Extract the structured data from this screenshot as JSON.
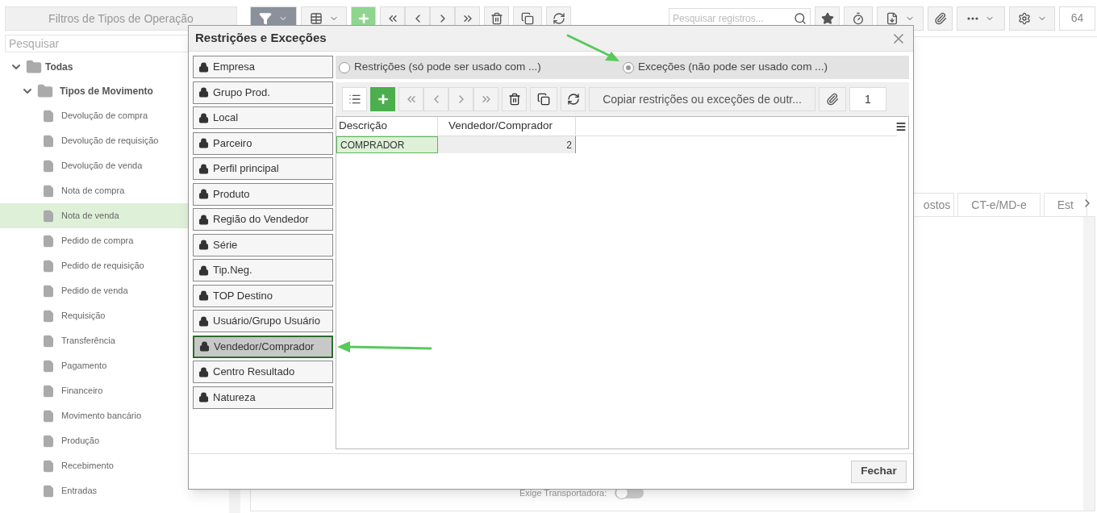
{
  "sidebar": {
    "title": "Filtros de Tipos de Operação",
    "search": {
      "placeholder": "Pesquisar"
    },
    "tree": [
      {
        "label": "Todas",
        "expanded": true,
        "children": [
          {
            "label": "Tipos de Movimento",
            "expanded": true,
            "children": [
              {
                "label": "Devolução de compra",
                "selected": false
              },
              {
                "label": "Devolução de requisição",
                "selected": false
              },
              {
                "label": "Devolução de venda",
                "selected": false
              },
              {
                "label": "Nota de compra",
                "selected": false
              },
              {
                "label": "Nota de venda",
                "selected": true
              },
              {
                "label": "Pedido de compra",
                "selected": false
              },
              {
                "label": "Pedido de requisição",
                "selected": false
              },
              {
                "label": "Pedido de venda",
                "selected": false
              },
              {
                "label": "Requisição",
                "selected": false
              },
              {
                "label": "Transferência",
                "selected": false
              },
              {
                "label": "Pagamento",
                "selected": false
              },
              {
                "label": "Financeiro",
                "selected": false
              },
              {
                "label": "Movimento bancário",
                "selected": false
              },
              {
                "label": "Produção",
                "selected": false
              },
              {
                "label": "Recebimento",
                "selected": false
              },
              {
                "label": "Entradas",
                "selected": false
              }
            ]
          }
        ]
      }
    ]
  },
  "toolbar": {
    "search": {
      "placeholder": "Pesquisar registros..."
    },
    "counter": "64"
  },
  "tabs": [
    {
      "label": "ostos"
    },
    {
      "label": "CT-e/MD-e"
    },
    {
      "label": "Est"
    }
  ],
  "form": {
    "label": "Exige Transportadora:",
    "on": false
  },
  "dialog": {
    "title": "Restrições e Exceções",
    "categories": [
      {
        "label": "Empresa",
        "selected": false
      },
      {
        "label": "Grupo Prod.",
        "selected": false
      },
      {
        "label": "Local",
        "selected": false
      },
      {
        "label": "Parceiro",
        "selected": false
      },
      {
        "label": "Perfil principal",
        "selected": false
      },
      {
        "label": "Produto",
        "selected": false
      },
      {
        "label": "Região do Vendedor",
        "selected": false
      },
      {
        "label": "Série",
        "selected": false
      },
      {
        "label": "Tip.Neg.",
        "selected": false
      },
      {
        "label": "TOP Destino",
        "selected": false
      },
      {
        "label": "Usuário/Grupo Usuário",
        "selected": false
      },
      {
        "label": "Vendedor/Comprador",
        "selected": true
      },
      {
        "label": "Centro Resultado",
        "selected": false
      },
      {
        "label": "Natureza",
        "selected": false
      }
    ],
    "modes": [
      {
        "label": "Restrições (só pode ser usado com ...)",
        "selected": false
      },
      {
        "label": "Exceções (não pode ser usado com ...)",
        "selected": true
      }
    ],
    "copy_button": "Copiar restrições ou exceções de outr...",
    "counter": "1",
    "columns": [
      "Descrição",
      "Vendedor/Comprador"
    ],
    "rows": [
      {
        "cells": [
          "COMPRADOR",
          "2"
        ],
        "selected": true
      }
    ],
    "close_button": "Fechar"
  }
}
